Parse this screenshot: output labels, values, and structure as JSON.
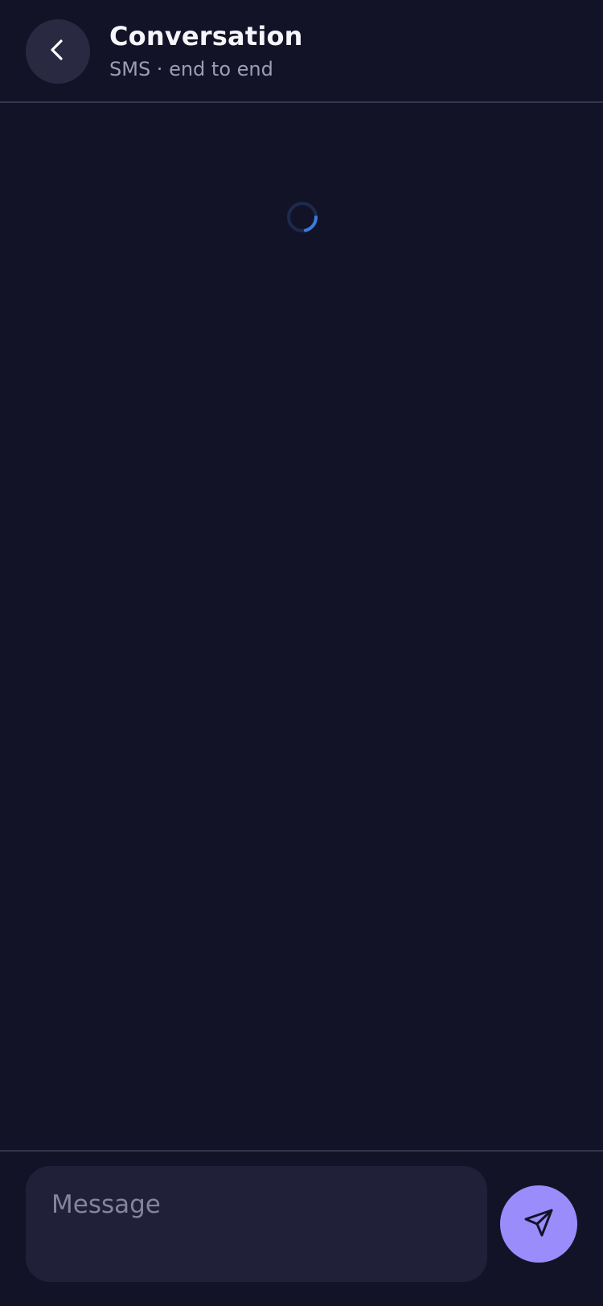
{
  "header": {
    "title": "Conversation",
    "subtitle": "SMS · end to end",
    "back_icon": "chevron-left-icon"
  },
  "messages": {
    "loading": true,
    "spinner_icon": "loading-spinner-icon"
  },
  "composer": {
    "placeholder": "Message",
    "value": "",
    "send_icon": "send-icon"
  },
  "colors": {
    "background": "#131327",
    "surface": "#2a2942",
    "input_background": "#212039",
    "accent": "#9b8cfb",
    "spinner_accent": "#3a7be0",
    "divider": "#34344d"
  }
}
